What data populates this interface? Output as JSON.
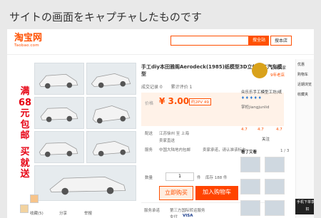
{
  "caption": "サイトの画面をキャプチャしたものです",
  "header": {
    "logo": "淘宝网",
    "logo_sub": "Taobao.com",
    "search_all": "搜全站",
    "search_store": "搜本店"
  },
  "promo": {
    "top": "满68元包邮",
    "bottom": "买就送"
  },
  "product": {
    "title": "手工diy本田雅阁Aerodeck(1985)纸模型3D立体手工汽车模型",
    "sales": "成交记录 0",
    "reviews": "累计评价 1",
    "price_label": "价格",
    "price": "¥ 3.00",
    "discount": "约2PV 49",
    "shipping_label": "配送",
    "shipping_to": "江苏徐州 至 上海",
    "delivery": "卖家直送",
    "service_label": "服务",
    "service_text": "中国大陆地内包邮",
    "service_extra": "卖家承诺，请认准该标志",
    "qty_label": "数量",
    "qty_value": "1",
    "qty_unit": "件",
    "stock": "库存 188 件",
    "buy_now": "立即购买",
    "add_cart": "加入购物车",
    "promise": "服务承诺",
    "promise_text": "第三方国际转运服务",
    "payment_label": "支付",
    "payment": "VISA"
  },
  "thumb_nav": "收藏(5)",
  "share": "分享",
  "report": "举报",
  "shop": {
    "badge": "钻级卖家",
    "years": "9年老店",
    "name": "众乐乐手工模型工坊(纸",
    "sub": "掌柜jiangjunlid",
    "rating": "4.7",
    "follow": "关注"
  },
  "sidebar": {
    "items": [
      "优惠",
      "购物车",
      "近期浏览",
      "收藏夹"
    ]
  },
  "related": "看了又看",
  "pagination": "1 / 3",
  "badge_bottom": "手机下单享折扣"
}
